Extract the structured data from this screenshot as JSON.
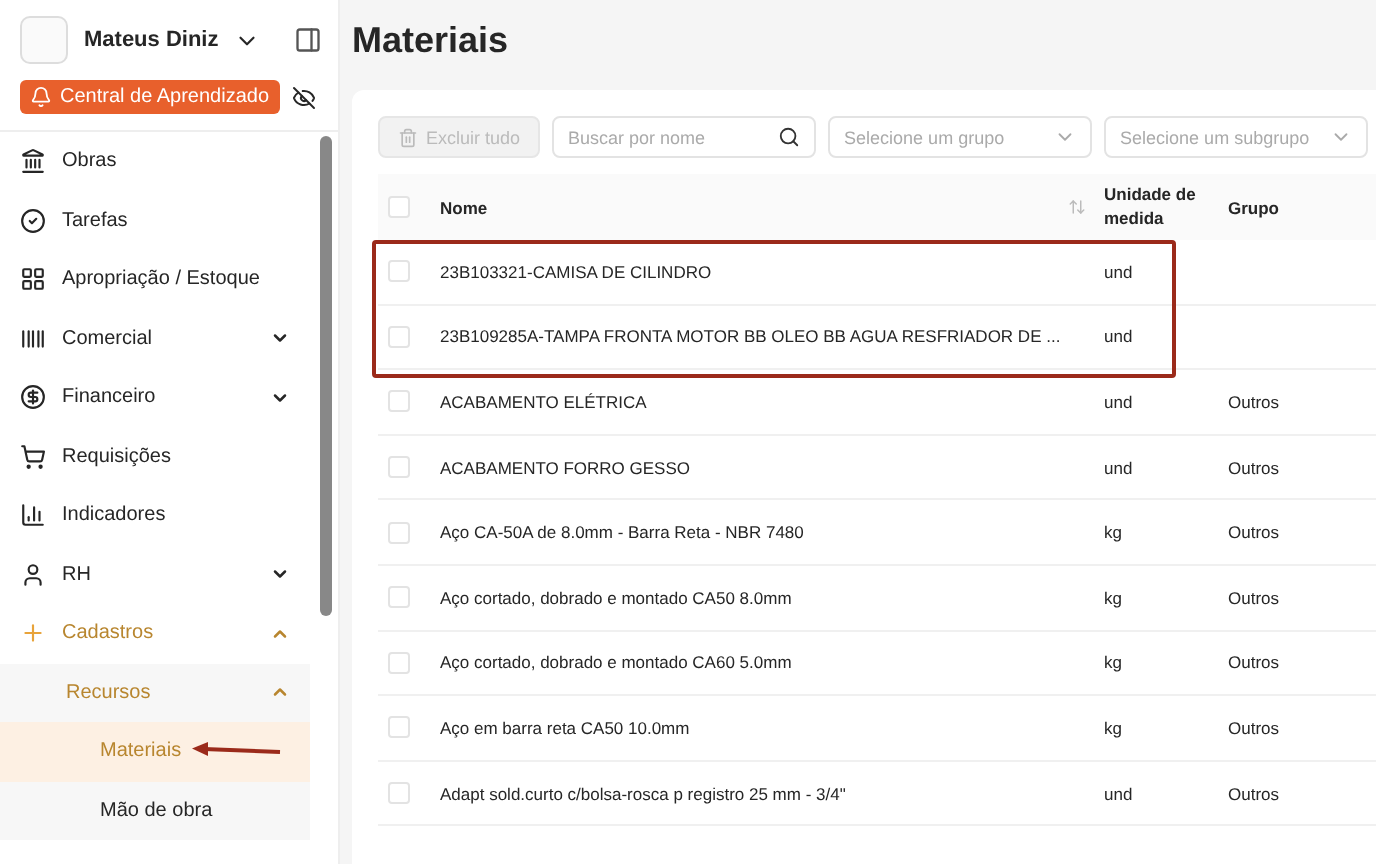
{
  "sidebar": {
    "user": {
      "name": "Mateus Diniz"
    },
    "learning_button": {
      "label": "Central de Aprendizado"
    },
    "items": [
      {
        "label": "Obras",
        "active": false
      },
      {
        "label": "Tarefas",
        "active": false
      },
      {
        "label": "Apropriação / Estoque",
        "active": false
      },
      {
        "label": "Comercial",
        "expanded": false,
        "active": false
      },
      {
        "label": "Financeiro",
        "expanded": false,
        "active": false
      },
      {
        "label": "Requisições",
        "active": false
      },
      {
        "label": "Indicadores",
        "active": false
      },
      {
        "label": "RH",
        "expanded": false,
        "active": false
      },
      {
        "label": "Cadastros",
        "expanded": true,
        "active": true,
        "children": [
          {
            "label": "Recursos",
            "expanded": true,
            "active": true,
            "children": [
              {
                "label": "Materiais",
                "selected": true
              },
              {
                "label": "Mão de obra",
                "selected": false
              }
            ]
          }
        ]
      }
    ]
  },
  "page": {
    "title": "Materiais"
  },
  "toolbar": {
    "delete_all": {
      "label": "Excluir tudo",
      "disabled": true
    },
    "search": {
      "placeholder": "Buscar por nome"
    },
    "group_select": {
      "placeholder": "Selecione um grupo"
    },
    "subgroup_select": {
      "placeholder": "Selecione um subgrupo"
    }
  },
  "table": {
    "select_all_checked": false,
    "columns": [
      "Nome",
      "Unidade de medida",
      "Grupo"
    ],
    "rows": [
      {
        "name": "23B103321-CAMISA DE CILINDRO",
        "unit": "und",
        "group": "",
        "checked": false,
        "highlighted": true
      },
      {
        "name": "23B109285A-TAMPA FRONTA MOTOR BB OLEO BB AGUA RESFRIADOR DE ...",
        "unit": "und",
        "group": "",
        "checked": false,
        "highlighted": true
      },
      {
        "name": "ACABAMENTO ELÉTRICA",
        "unit": "und",
        "group": "Outros",
        "checked": false,
        "highlighted": false
      },
      {
        "name": "ACABAMENTO FORRO GESSO",
        "unit": "und",
        "group": "Outros",
        "checked": false,
        "highlighted": false
      },
      {
        "name": "Aço CA-50A de 8.0mm - Barra Reta - NBR 7480",
        "unit": "kg",
        "group": "Outros",
        "checked": false,
        "highlighted": false
      },
      {
        "name": "Aço cortado, dobrado e montado CA50 8.0mm",
        "unit": "kg",
        "group": "Outros",
        "checked": false,
        "highlighted": false
      },
      {
        "name": "Aço cortado, dobrado e montado CA60 5.0mm",
        "unit": "kg",
        "group": "Outros",
        "checked": false,
        "highlighted": false
      },
      {
        "name": "Aço em barra reta CA50 10.0mm",
        "unit": "kg",
        "group": "Outros",
        "checked": false,
        "highlighted": false
      },
      {
        "name": "Adapt sold.curto c/bolsa-rosca p registro 25 mm - 3/4\"",
        "unit": "und",
        "group": "Outros",
        "checked": false,
        "highlighted": false
      }
    ]
  }
}
